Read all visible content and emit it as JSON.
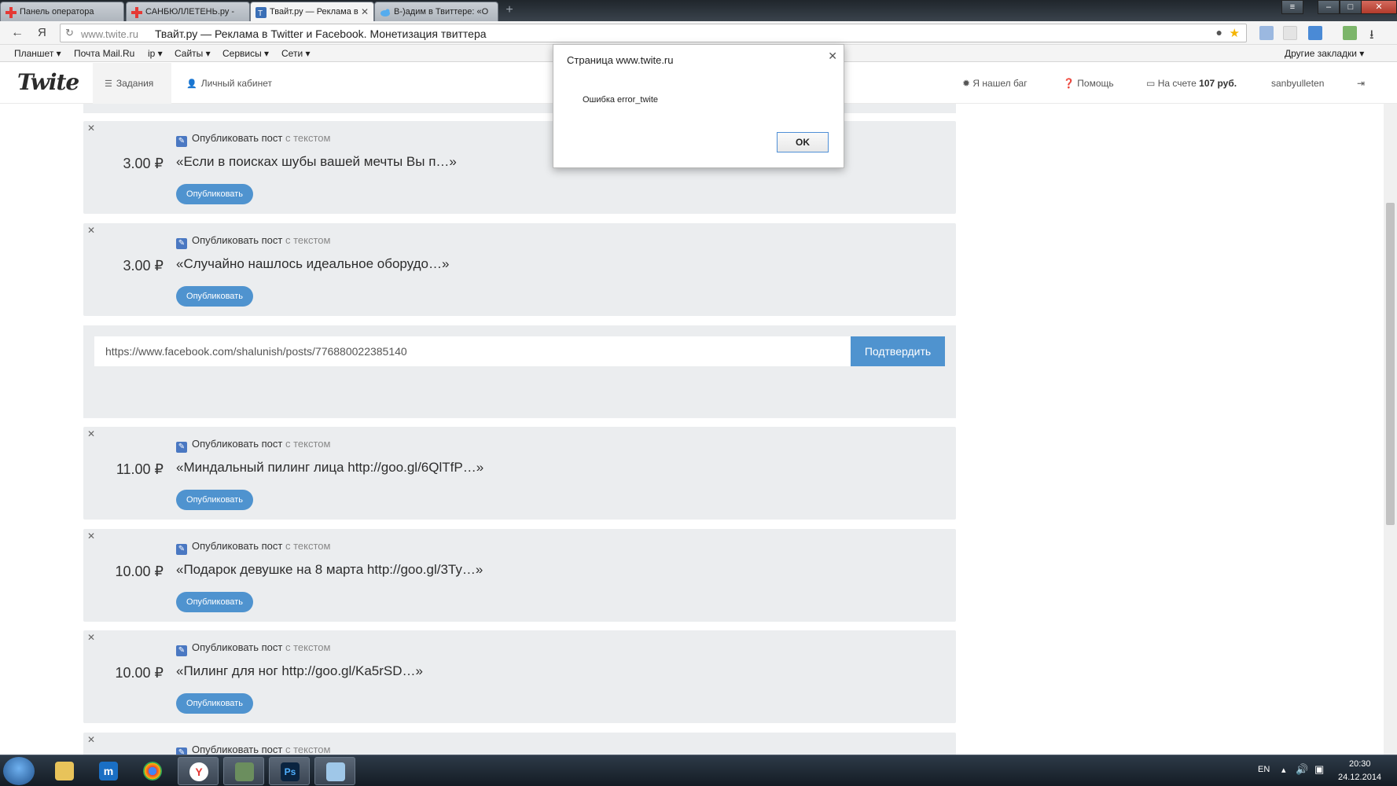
{
  "browser": {
    "tabs": [
      {
        "label": "Панель оператора",
        "favicon_color": "#e53935"
      },
      {
        "label": "САНБЮЛЛЕТЕНЬ.ру - ",
        "favicon_color": "#e53935"
      },
      {
        "label": "Твайт.ру — Реклама в",
        "favicon_color": "#3b6fb6",
        "active": true
      },
      {
        "label": "В-)адим в Твиттере: «О",
        "favicon_color": "#55acee"
      }
    ],
    "address": {
      "host": "www.twite.ru",
      "title": "Твайт.ру — Реклама в Twitter и Facebook. Монетизация твиттера"
    },
    "bookmarks": [
      {
        "label": "Планшет ▾"
      },
      {
        "label": "Почта Mail.Ru"
      },
      {
        "label": "ip ▾"
      },
      {
        "label": "Сайты ▾"
      },
      {
        "label": "Сервисы ▾"
      },
      {
        "label": "Сети ▾"
      }
    ],
    "other_bookmarks": "Другие закладки ▾"
  },
  "site": {
    "logo": "Twite",
    "nav": {
      "tasks": "Задания",
      "cabinet": "Личный кабинет",
      "bug": "Я нашел баг",
      "help": "Помощь",
      "balance_prefix": "На счете",
      "balance_value": "107 руб.",
      "username": "sanbyulleten"
    }
  },
  "tasks": [
    {
      "price": "3.00 ₽",
      "type_label": "Опубликовать пост",
      "type_suffix": "с текстом",
      "quote": "«Если в поисках шубы вашей мечты Вы п…»",
      "button": "Опубликовать"
    },
    {
      "price": "3.00 ₽",
      "type_label": "Опубликовать пост",
      "type_suffix": "с текстом",
      "quote": "«Случайно нашлось идеальное оборудо…»",
      "button": "Опубликовать"
    },
    {
      "price": "11.00 ₽",
      "type_label": "Опубликовать пост",
      "type_suffix": "с текстом",
      "quote": "«Миндальный пилинг лица http://goo.gl/6QlTfP…»",
      "button": "Опубликовать"
    },
    {
      "price": "10.00 ₽",
      "type_label": "Опубликовать пост",
      "type_suffix": "с текстом",
      "quote": "«Подарок девушке на 8 марта http://goo.gl/3Ty…»",
      "button": "Опубликовать"
    },
    {
      "price": "10.00 ₽",
      "type_label": "Опубликовать пост",
      "type_suffix": "с текстом",
      "quote": "«Пилинг для ног http://goo.gl/Ka5rSD…»",
      "button": "Опубликовать"
    },
    {
      "price": "",
      "type_label": "Опубликовать пост",
      "type_suffix": "с текстом",
      "quote": "",
      "button": ""
    }
  ],
  "confirm": {
    "value": "https://www.facebook.com/shalunish/posts/776880022385140",
    "button": "Подтвердить"
  },
  "dialog": {
    "title": "Страница www.twite.ru",
    "message": "Ошибка error_twite",
    "ok": "OK"
  },
  "taskbar": {
    "lang": "EN",
    "time": "20:30",
    "date": "24.12.2014"
  },
  "colors": {
    "accent": "#4f93cf",
    "card_bg": "#ebedef",
    "checkbox": "#4a78c2"
  }
}
